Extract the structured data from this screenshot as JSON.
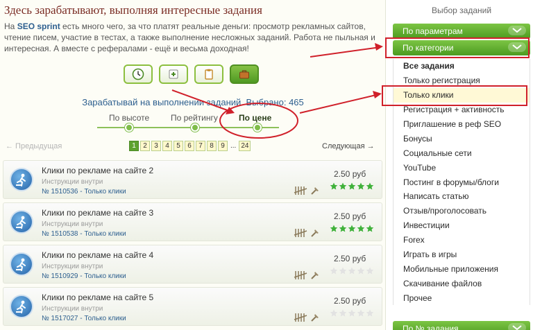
{
  "main": {
    "headline": "Здесь зарабатывают, выполняя интересные задания",
    "intro_prefix": "На ",
    "intro_brand": "SEO sprint",
    "intro_rest": " есть много чего, за что платят реальные деньги: просмотр рекламных сайтов, чтение писем, участие в тестах, а также выполнение несложных заданий. Работа не пыльная и интересная. А вместе с рефералами - ещё и весьма доходная!",
    "earn_line": "Зарабатывай на выполнении заданий. Выбрано: 465",
    "tool_icons": [
      "clock-icon",
      "add-task-icon",
      "clipboard-icon",
      "briefcase-icon"
    ],
    "sort": {
      "by_height": "По высоте",
      "by_rating": "По рейтингу",
      "by_price": "По цене"
    },
    "pager": {
      "prev": "← Предыдущая",
      "next": "Следующая →",
      "pages": [
        "1",
        "2",
        "3",
        "4",
        "5",
        "6",
        "7",
        "8",
        "9"
      ],
      "dots": "...",
      "last": "24"
    },
    "tasks": [
      {
        "title": "Клики по рекламе на сайте 2",
        "sub": "Инструкции внутри",
        "meta": "№ 1510536 - Только клики",
        "price": "2.50 руб",
        "rating": 5
      },
      {
        "title": "Клики по рекламе на сайте 3",
        "sub": "Инструкции внутри",
        "meta": "№ 1510538 - Только клики",
        "price": "2.50 руб",
        "rating": 5
      },
      {
        "title": "Клики по рекламе на сайте 4",
        "sub": "Инструкции внутри",
        "meta": "№ 1510929 - Только клики",
        "price": "2.50 руб",
        "rating": 0
      },
      {
        "title": "Клики по рекламе на сайте 5",
        "sub": "Инструкции внутри",
        "meta": "№ 1517027 - Только клики",
        "price": "2.50 руб",
        "rating": 0
      }
    ]
  },
  "sidebar": {
    "title": "Выбор заданий",
    "by_params": "По параметрам",
    "by_category": "По категории",
    "items": [
      "Все задания",
      "Только регистрация",
      "Только клики",
      "Регистрация + активность",
      "Приглашение в реф SEO",
      "Бонусы",
      "Социальные сети",
      "YouTube",
      "Постинг в форумы/блоги",
      "Написать статью",
      "Отзыв/проголосовать",
      "Инвестиции",
      "Forex",
      "Играть в игры",
      "Мобильные приложения",
      "Скачивание файлов",
      "Прочее"
    ],
    "by_number": "По № задания"
  },
  "colors": {
    "accent_green": "#5da22f",
    "annotation_red": "#d0202a",
    "link_blue": "#2d5f8f",
    "star_on": "#3fb13a",
    "star_off": "#e2e2e2"
  }
}
